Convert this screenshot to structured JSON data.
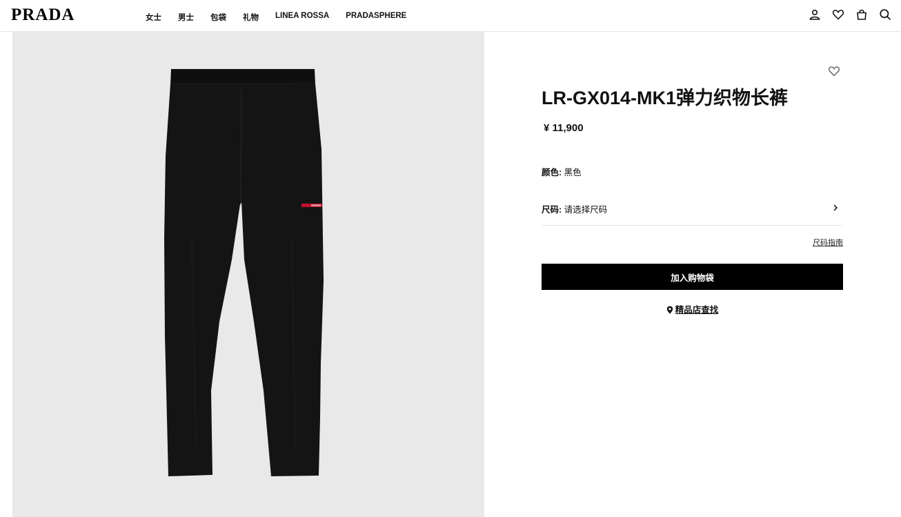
{
  "brand": "PRADA",
  "nav": {
    "items": [
      "女士",
      "男士",
      "包袋",
      "礼物",
      "LINEA ROSSA",
      "PRADASPHERE"
    ]
  },
  "header_icons": [
    "user-icon",
    "heart-icon",
    "bag-icon",
    "search-icon"
  ],
  "product": {
    "title": "LR-GX014-MK1弹力织物长裤",
    "price": "¥ 11,900",
    "color_label": "颜色:",
    "color_value": "黑色",
    "size_label": "尺码:",
    "size_placeholder": "请选择尺码",
    "size_guide": "尺码指南",
    "add_to_bag": "加入购物袋",
    "store_finder": "精品店查找",
    "image_subject": "black pants with red Linea Rossa tab"
  },
  "colors": {
    "accent": "#000000",
    "image_background": "#e9e9e9",
    "logo_tab": "#c8102e"
  }
}
